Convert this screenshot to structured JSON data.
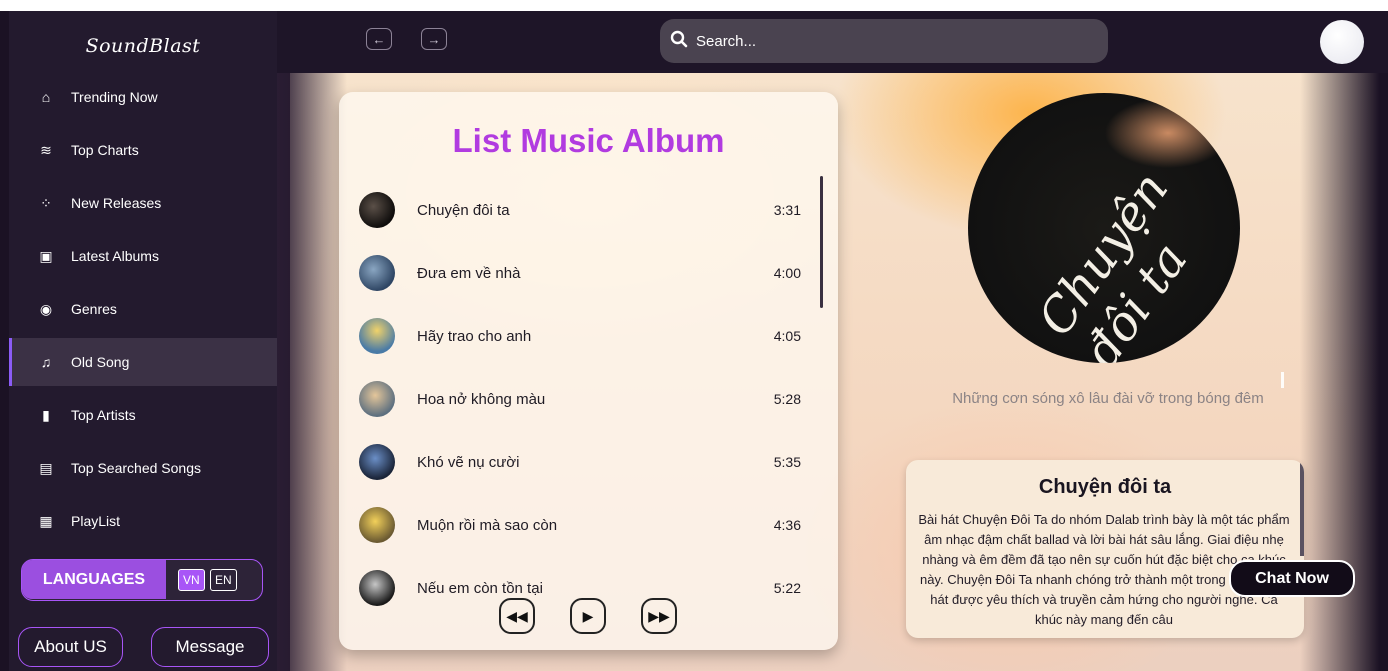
{
  "app": {
    "logo": "SoundBlast"
  },
  "sidebar": {
    "items": [
      {
        "label": "Trending Now",
        "icon": "home-icon"
      },
      {
        "label": "Top Charts",
        "icon": "sliders-icon"
      },
      {
        "label": "New Releases",
        "icon": "spinner-icon"
      },
      {
        "label": "Latest Albums",
        "icon": "album-icon"
      },
      {
        "label": "Genres",
        "icon": "record-icon"
      },
      {
        "label": "Old Song",
        "icon": "music-note-icon",
        "active": true
      },
      {
        "label": "Top Artists",
        "icon": "bar-chart-icon"
      },
      {
        "label": "Top Searched Songs",
        "icon": "keyboard-icon"
      },
      {
        "label": "PlayList",
        "icon": "film-icon"
      }
    ],
    "languages": {
      "title": "LANGUAGES",
      "options": [
        "VN",
        "EN"
      ],
      "selected": "VN"
    },
    "about_label": "About US",
    "message_label": "Message"
  },
  "header": {
    "search_placeholder": "Search..."
  },
  "album": {
    "title": "List Music Album",
    "songs": [
      {
        "name": "Chuyện đôi ta",
        "duration": "3:31"
      },
      {
        "name": "Đưa em về nhà",
        "duration": "4:00"
      },
      {
        "name": "Hãy trao cho anh",
        "duration": "4:05"
      },
      {
        "name": "Hoa nở không màu",
        "duration": "5:28"
      },
      {
        "name": "Khó vẽ nụ cười",
        "duration": "5:35"
      },
      {
        "name": "Muộn rồi mà sao còn",
        "duration": "4:36"
      },
      {
        "name": "Nếu em còn tồn tại",
        "duration": "5:22"
      }
    ]
  },
  "now_playing": {
    "disc_text": "Chuyện đôi ta",
    "lyric": "Những cơn sóng xô lâu đài vỡ trong bóng đêm",
    "title": "Chuyện đôi ta",
    "description": "Bài hát Chuyện Đôi Ta do nhóm Dalab trình bày là một tác phẩm âm nhạc đậm chất ballad và lời bài hát sâu lắng. Giai điệu nhẹ nhàng và êm đềm đã tạo nên sự cuốn hút đặc biệt cho ca khúc này. Chuyện Đôi Ta nhanh chóng trở thành một trong những bài hát được yêu thích và truyền cảm hứng cho người nghe. Ca khúc này mang đến câu"
  },
  "chat": {
    "label": "Chat Now"
  },
  "colors": {
    "accent": "#a855f7",
    "title": "#b13be0",
    "sidebar": "#231a2e"
  }
}
